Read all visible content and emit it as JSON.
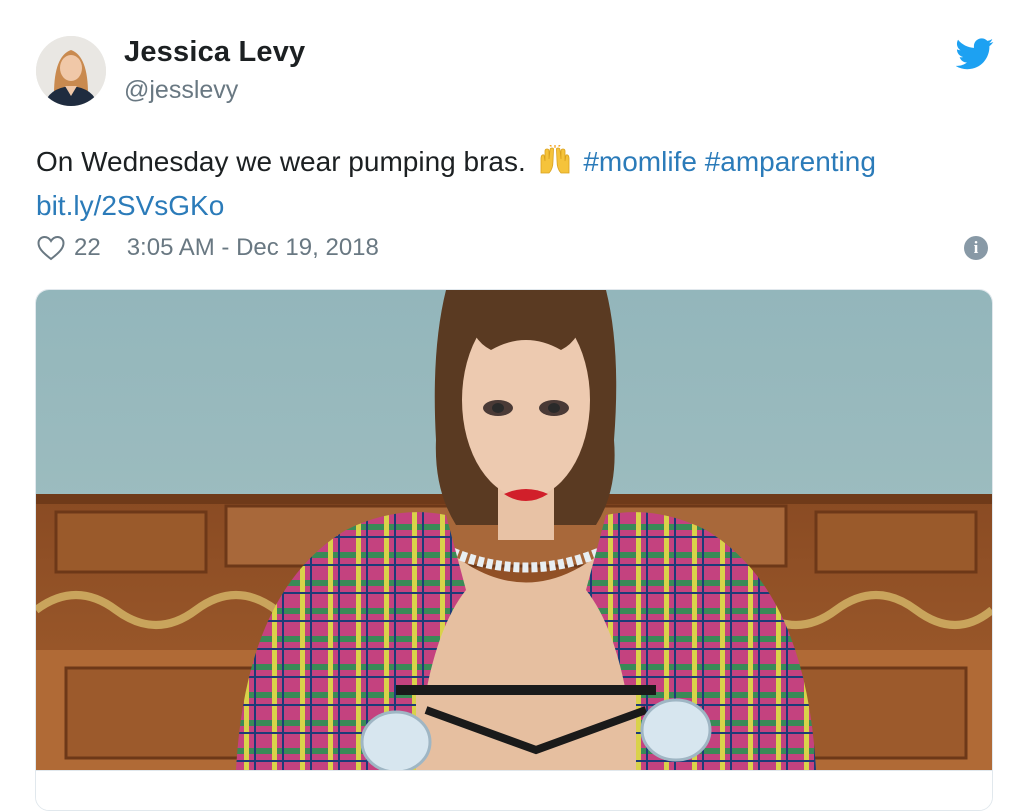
{
  "author": {
    "name": "Jessica Levy",
    "handle": "@jesslevy",
    "avatar_icon": "profile-photo"
  },
  "brand_icon": "twitter-bird-icon",
  "brand_color": "#1da1f2",
  "link_color": "#2b7bb9",
  "tweet": {
    "text": "On Wednesday we wear pumping bras.",
    "emoji": "raising-hands-emoji",
    "hashtags": [
      "#momlife",
      "#amparenting"
    ],
    "url": "bit.ly/2SVsGKo"
  },
  "meta": {
    "likes": "22",
    "timestamp": "3:05 AM - Dec 19, 2018",
    "heart_icon": "heart-outline-icon",
    "info_icon": "info-icon",
    "info_glyph": "i"
  },
  "media": {
    "image_icon": "photo-woman-plaid-jacket-breast-pump"
  }
}
